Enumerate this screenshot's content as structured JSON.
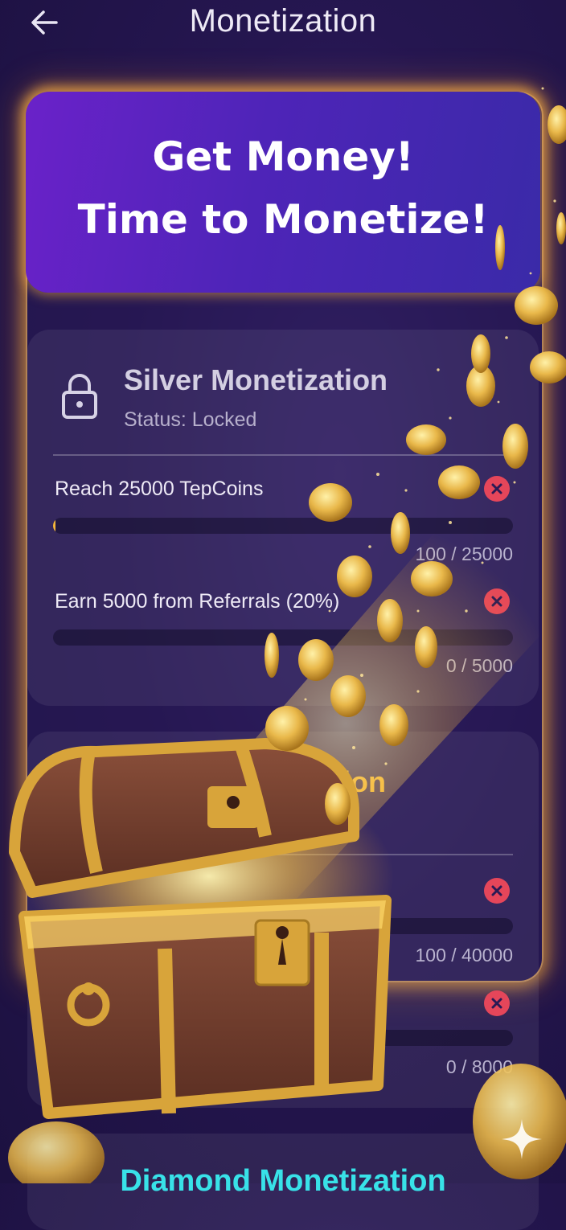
{
  "header": {
    "title": "Monetization"
  },
  "banner": {
    "line1": "Get Money!",
    "line2": "Time to Monetize!"
  },
  "tiers": {
    "silver": {
      "name": "Silver Monetization",
      "status": "Status: Locked",
      "requirements": [
        {
          "label": "Reach 25000 TepCoins",
          "value": "100 / 25000",
          "progress": 0.004
        },
        {
          "label": "Earn 5000 from Referrals (20%)",
          "value": "0 / 5000",
          "progress": 0
        }
      ]
    },
    "gold": {
      "name": "tion",
      "requirements": [
        {
          "label": "",
          "value": "100 / 40000",
          "progress": 0.0025
        },
        {
          "label": "",
          "value": "0 / 8000",
          "progress": 0
        }
      ]
    },
    "diamond": {
      "name": "Diamond Monetization"
    }
  },
  "icons": {
    "back": "arrow-left-icon",
    "lock": "lock-icon",
    "not_met": "close-circle-icon",
    "sparkle": "sparkle-icon"
  },
  "colors": {
    "accent_gold": "#f2b53a",
    "accent_red": "#e5465a",
    "accent_cyan": "#38e2e8",
    "banner_purple": "#6a22c9"
  }
}
